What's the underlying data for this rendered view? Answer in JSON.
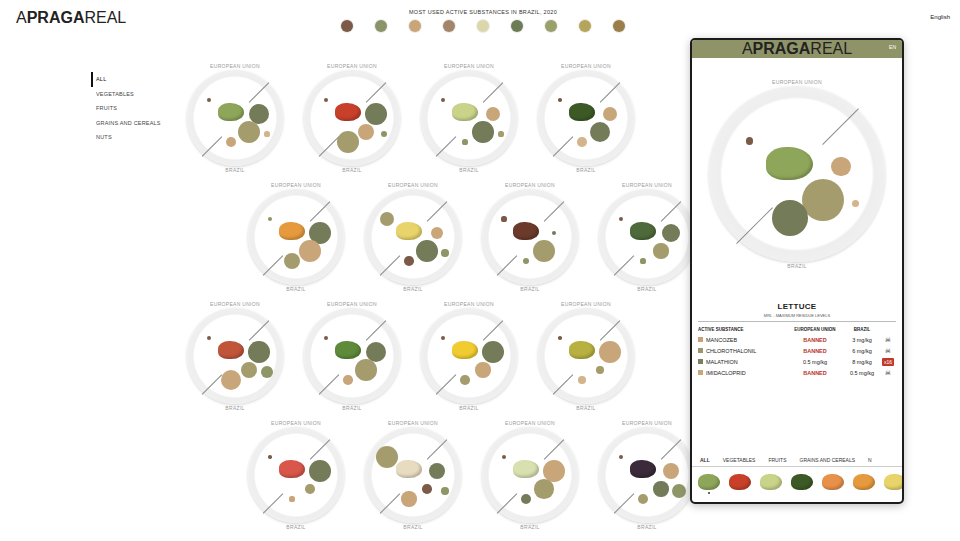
{
  "header": {
    "logo": {
      "prefix": "A",
      "bold": "PRAGA",
      "suffix": "REAL"
    },
    "title": "MOST USED ACTIVE SUBSTANCES IN BRAZIL, 2020",
    "language": "English"
  },
  "legend": [
    {
      "color": "#7b5b47"
    },
    {
      "color": "#8a9468"
    },
    {
      "color": "#c9a577"
    },
    {
      "color": "#a3866a"
    },
    {
      "color": "#dcd7ab"
    },
    {
      "color": "#6e7c55"
    },
    {
      "color": "#9aa06a"
    },
    {
      "color": "#b5a55a"
    },
    {
      "color": "#9a7f4a"
    }
  ],
  "sidebar": {
    "items": [
      {
        "label": "ALL",
        "selected": true
      },
      {
        "label": "VEGETABLES",
        "selected": false
      },
      {
        "label": "FRUITS",
        "selected": false
      },
      {
        "label": "GRAINS AND CEREALS",
        "selected": false
      },
      {
        "label": "NUTS",
        "selected": false
      }
    ]
  },
  "plate_labels": {
    "top": "EUROPEAN UNION",
    "bottom": "BRAZIL"
  },
  "plate_rows": [
    [
      {
        "food_color": "#8ea65a",
        "bubbles": [
          {
            "color": "#7b5b47",
            "level": 0.05
          },
          {
            "color": "#737b58",
            "level": 0.8
          },
          {
            "color": "#a59c6e",
            "level": 0.9
          },
          {
            "color": "#c9a57a",
            "level": 0.35
          },
          {
            "color": "#d4b48a",
            "level": 0.1
          }
        ]
      },
      {
        "food_color": "#c8402a",
        "bubbles": [
          {
            "color": "#7b5b47",
            "level": 0.05
          },
          {
            "color": "#737b58",
            "level": 0.9
          },
          {
            "color": "#c9a57a",
            "level": 0.6
          },
          {
            "color": "#a59c6e",
            "level": 0.9
          },
          {
            "color": "#8e9667",
            "level": 0.15
          }
        ]
      },
      {
        "food_color": "#c9d38a",
        "bubbles": [
          {
            "color": "#7b5b47",
            "level": 0.08
          },
          {
            "color": "#c9a57a",
            "level": 0.5
          },
          {
            "color": "#737b58",
            "level": 0.85
          },
          {
            "color": "#8e9667",
            "level": 0.1
          },
          {
            "color": "#a59c6e",
            "level": 0.1
          }
        ]
      },
      {
        "food_color": "#3d5a26",
        "bubbles": [
          {
            "color": "#7b5b47",
            "level": 0.03
          },
          {
            "color": "#c9a57a",
            "level": 0.5
          },
          {
            "color": "#737b58",
            "level": 0.8
          },
          {
            "color": "#d4b48a",
            "level": 0.3
          }
        ]
      }
    ],
    [
      {
        "food_color": "#e59a3d",
        "bubbles": [
          {
            "color": "#8e9667",
            "level": 0.05
          },
          {
            "color": "#737b58",
            "level": 0.9
          },
          {
            "color": "#c9a57a",
            "level": 0.85
          },
          {
            "color": "#a59c6e",
            "level": 0.6
          }
        ]
      },
      {
        "food_color": "#e8d46a",
        "bubbles": [
          {
            "color": "#a59c6e",
            "level": 0.5
          },
          {
            "color": "#c9a57a",
            "level": 0.45
          },
          {
            "color": "#737b58",
            "level": 0.85
          },
          {
            "color": "#7b5b47",
            "level": 0.3
          },
          {
            "color": "#8e9667",
            "level": 0.2
          }
        ]
      },
      {
        "food_color": "#6b3a2a",
        "bubbles": [
          {
            "color": "#7b5b47",
            "level": 0.1
          },
          {
            "color": "#737b58",
            "level": 0.05
          },
          {
            "color": "#a59c6e",
            "level": 0.85
          },
          {
            "color": "#8e9667",
            "level": 0.15
          }
        ]
      },
      {
        "food_color": "#4e6a3a",
        "bubbles": [
          {
            "color": "#7b5b47",
            "level": 0.05
          },
          {
            "color": "#737b58",
            "level": 0.7
          },
          {
            "color": "#a59c6e",
            "level": 0.55
          },
          {
            "color": "#8e9667",
            "level": 0.1
          }
        ]
      }
    ],
    [
      {
        "food_color": "#c0553a",
        "bubbles": [
          {
            "color": "#7b5b47",
            "level": 0.08
          },
          {
            "color": "#737b58",
            "level": 0.85
          },
          {
            "color": "#a59c6e",
            "level": 0.6
          },
          {
            "color": "#c9a57a",
            "level": 0.8
          },
          {
            "color": "#8e9667",
            "level": 0.4
          }
        ]
      },
      {
        "food_color": "#5e8a3a",
        "bubbles": [
          {
            "color": "#7b5b47",
            "level": 0.05
          },
          {
            "color": "#737b58",
            "level": 0.8
          },
          {
            "color": "#a59c6e",
            "level": 0.85
          },
          {
            "color": "#c9a57a",
            "level": 0.3
          }
        ]
      },
      {
        "food_color": "#f0cc30",
        "bubbles": [
          {
            "color": "#7b5b47",
            "level": 0.05
          },
          {
            "color": "#737b58",
            "level": 0.9
          },
          {
            "color": "#c9a57a",
            "level": 0.55
          },
          {
            "color": "#a59c6e",
            "level": 0.3
          }
        ]
      },
      {
        "food_color": "#b8b040",
        "bubbles": [
          {
            "color": "#7b5b47",
            "level": 0.03
          },
          {
            "color": "#c9a57a",
            "level": 0.85
          },
          {
            "color": "#a59c6e",
            "level": 0.2
          },
          {
            "color": "#d4b48a",
            "level": 0.2
          }
        ]
      }
    ],
    [
      {
        "food_color": "#d9564a",
        "bubbles": [
          {
            "color": "#7b5b47",
            "level": 0.03
          },
          {
            "color": "#737b58",
            "level": 0.85
          },
          {
            "color": "#a59c6e",
            "level": 0.3
          },
          {
            "color": "#c9a57a",
            "level": 0.1
          }
        ]
      },
      {
        "food_color": "#e8dcc0",
        "bubbles": [
          {
            "color": "#a59c6e",
            "level": 0.9
          },
          {
            "color": "#737b58",
            "level": 0.6
          },
          {
            "color": "#7b5b47",
            "level": 0.3
          },
          {
            "color": "#c9a57a",
            "level": 0.55
          },
          {
            "color": "#8e9667",
            "level": 0.2
          }
        ]
      },
      {
        "food_color": "#d8e0b0",
        "bubbles": [
          {
            "color": "#7b5b47",
            "level": 0.05
          },
          {
            "color": "#c9a57a",
            "level": 0.85
          },
          {
            "color": "#a59c6e",
            "level": 0.75
          },
          {
            "color": "#737b58",
            "level": 0.35
          }
        ]
      },
      {
        "food_color": "#3a2a3a",
        "bubbles": [
          {
            "color": "#7b5b47",
            "level": 0.05
          },
          {
            "color": "#c9a57a",
            "level": 0.6
          },
          {
            "color": "#737b58",
            "level": 0.55
          },
          {
            "color": "#a59c6e",
            "level": 0.35
          },
          {
            "color": "#8e9667",
            "level": 0.5
          }
        ]
      }
    ]
  ],
  "detail": {
    "language": "EN",
    "plate": {
      "food_color": "#8ea65a",
      "bubbles": [
        {
          "color": "#7b5b47",
          "level": 0.05
        },
        {
          "color": "#c9a57a",
          "level": 0.35
        },
        {
          "color": "#a59c6e",
          "level": 0.9
        },
        {
          "color": "#737b58",
          "level": 0.75
        },
        {
          "color": "#d4b48a",
          "level": 0.05
        }
      ]
    },
    "title": "LETTUCE",
    "subtitle": "MRL - MAXIMUM RESIDUE LEVELS",
    "columns": [
      "ACTIVE SUBSTANCE",
      "EUROPEAN UNION",
      "BRAZIL"
    ],
    "rows": [
      {
        "color": "#c9a07a",
        "name": "MANCOZEB",
        "eu": "BANNED",
        "banned": true,
        "brazil": "3 mg/kg",
        "flag": {
          "kind": "icon",
          "text": "☠"
        }
      },
      {
        "color": "#9a9670",
        "name": "CHLOROTHALONIL",
        "eu": "BANNED",
        "banned": true,
        "brazil": "6 mg/kg",
        "flag": {
          "kind": "icon",
          "text": "☠"
        }
      },
      {
        "color": "#7b7f5e",
        "name": "MALATHION",
        "eu": "0.5 mg/kg",
        "banned": false,
        "brazil": "8 mg/kg",
        "flag": {
          "kind": "badge",
          "text": "x16"
        }
      },
      {
        "color": "#c8a77a",
        "name": "IMIDACLOPRID",
        "eu": "BANNED",
        "banned": true,
        "brazil": "0.5 mg/kg",
        "flag": {
          "kind": "icon",
          "text": "☠"
        }
      }
    ],
    "tabs": [
      {
        "label": "ALL",
        "selected": true
      },
      {
        "label": "VEGETABLES",
        "selected": false
      },
      {
        "label": "FRUITS",
        "selected": false
      },
      {
        "label": "GRAINS AND CEREALS",
        "selected": false
      },
      {
        "label": "N",
        "selected": false
      }
    ],
    "thumbnails": [
      {
        "color": "#8ea65a",
        "selected": true
      },
      {
        "color": "#c8402a",
        "selected": false
      },
      {
        "color": "#c9d38a",
        "selected": false
      },
      {
        "color": "#3d5a26",
        "selected": false
      },
      {
        "color": "#e8914a",
        "selected": false
      },
      {
        "color": "#e59a3d",
        "selected": false
      },
      {
        "color": "#e8d46a",
        "selected": false
      }
    ]
  }
}
